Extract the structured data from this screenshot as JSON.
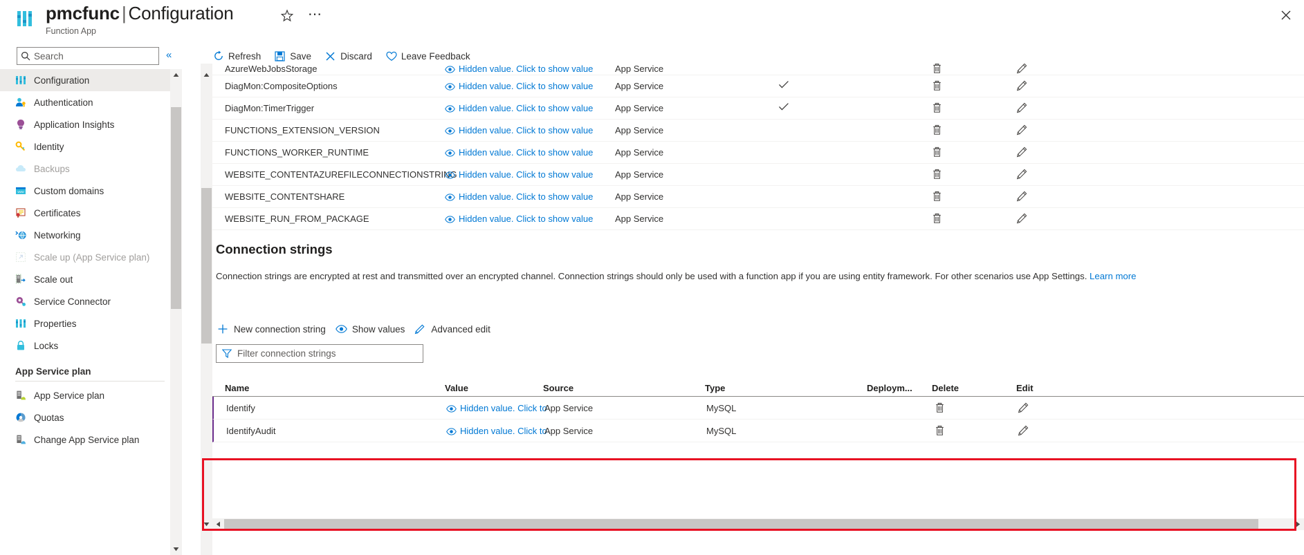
{
  "header": {
    "resource_name": "pmcfunc",
    "separator": "|",
    "page_name": "Configuration",
    "subtitle": "Function App",
    "favorite_icon": "star-icon",
    "more_icon": "ellipsis-icon",
    "close_icon": "close-icon",
    "logo_icon": "function-app-icon"
  },
  "search": {
    "placeholder": "Search",
    "value": "",
    "icon": "search-icon",
    "collapse_label": "«"
  },
  "sidebar": {
    "items": [
      {
        "label": "Configuration",
        "icon": "configuration-icon",
        "selected": true,
        "disabled": false
      },
      {
        "label": "Authentication",
        "icon": "authentication-icon",
        "selected": false,
        "disabled": false
      },
      {
        "label": "Application Insights",
        "icon": "application-insights-icon",
        "selected": false,
        "disabled": false
      },
      {
        "label": "Identity",
        "icon": "identity-key-icon",
        "selected": false,
        "disabled": false
      },
      {
        "label": "Backups",
        "icon": "backups-cloud-icon",
        "selected": false,
        "disabled": true
      },
      {
        "label": "Custom domains",
        "icon": "custom-domains-icon",
        "selected": false,
        "disabled": false
      },
      {
        "label": "Certificates",
        "icon": "certificates-icon",
        "selected": false,
        "disabled": false
      },
      {
        "label": "Networking",
        "icon": "networking-icon",
        "selected": false,
        "disabled": false
      },
      {
        "label": "Scale up (App Service plan)",
        "icon": "scale-up-icon",
        "selected": false,
        "disabled": true
      },
      {
        "label": "Scale out",
        "icon": "scale-out-icon",
        "selected": false,
        "disabled": false
      },
      {
        "label": "Service Connector",
        "icon": "service-connector-icon",
        "selected": false,
        "disabled": false
      },
      {
        "label": "Properties",
        "icon": "properties-icon",
        "selected": false,
        "disabled": false
      },
      {
        "label": "Locks",
        "icon": "locks-icon",
        "selected": false,
        "disabled": false
      }
    ],
    "group_label": "App Service plan",
    "group_items": [
      {
        "label": "App Service plan",
        "icon": "app-service-plan-icon",
        "selected": false,
        "disabled": false
      },
      {
        "label": "Quotas",
        "icon": "quotas-icon",
        "selected": false,
        "disabled": false
      },
      {
        "label": "Change App Service plan",
        "icon": "change-app-service-plan-icon",
        "selected": false,
        "disabled": false
      }
    ]
  },
  "toolbar": {
    "refresh_label": "Refresh",
    "save_label": "Save",
    "discard_label": "Discard",
    "feedback_label": "Leave Feedback"
  },
  "app_settings": {
    "hidden_value_text": "Hidden value. Click to show value",
    "source_text": "App Service",
    "rows": [
      {
        "name": "AzureWebJobsStorage",
        "value": "Hidden value. Click to show value",
        "source": "App Service",
        "slot_setting": false
      },
      {
        "name": "DiagMon:CompositeOptions",
        "value": "Hidden value. Click to show value",
        "source": "App Service",
        "slot_setting": true
      },
      {
        "name": "DiagMon:TimerTrigger",
        "value": "Hidden value. Click to show value",
        "source": "App Service",
        "slot_setting": true
      },
      {
        "name": "FUNCTIONS_EXTENSION_VERSION",
        "value": "Hidden value. Click to show value",
        "source": "App Service",
        "slot_setting": false
      },
      {
        "name": "FUNCTIONS_WORKER_RUNTIME",
        "value": "Hidden value. Click to show value",
        "source": "App Service",
        "slot_setting": false
      },
      {
        "name": "WEBSITE_CONTENTAZUREFILECONNECTIONSTRING",
        "value": "Hidden value. Click to show value",
        "source": "App Service",
        "slot_setting": false
      },
      {
        "name": "WEBSITE_CONTENTSHARE",
        "value": "Hidden value. Click to show value",
        "source": "App Service",
        "slot_setting": false
      },
      {
        "name": "WEBSITE_RUN_FROM_PACKAGE",
        "value": "Hidden value. Click to show value",
        "source": "App Service",
        "slot_setting": false
      }
    ]
  },
  "connection_strings": {
    "heading": "Connection strings",
    "description": "Connection strings are encrypted at rest and transmitted over an encrypted channel. Connection strings should only be used with a function app if you are using entity framework. For other scenarios use App Settings.",
    "learn_more": "Learn more",
    "new_label": "New connection string",
    "show_values_label": "Show values",
    "advanced_edit_label": "Advanced edit",
    "filter_placeholder": "Filter connection strings",
    "filter_value": "",
    "columns": {
      "name": "Name",
      "value": "Value",
      "source": "Source",
      "type": "Type",
      "deployment": "Deploym...",
      "delete": "Delete",
      "edit": "Edit"
    },
    "rows": [
      {
        "name": "Identify",
        "value": "Hidden value. Click to",
        "source": "App Service",
        "type": "MySQL",
        "deployment": ""
      },
      {
        "name": "IdentifyAudit",
        "value": "Hidden value. Click to",
        "source": "App Service",
        "type": "MySQL",
        "deployment": ""
      }
    ]
  },
  "colors": {
    "accent": "#0078d4",
    "annotation": "#e81123",
    "selected_row_marker": "#6b2d8c",
    "scroll_thumb": "#c8c6c4",
    "nav_selected_bg": "#edebe9"
  }
}
